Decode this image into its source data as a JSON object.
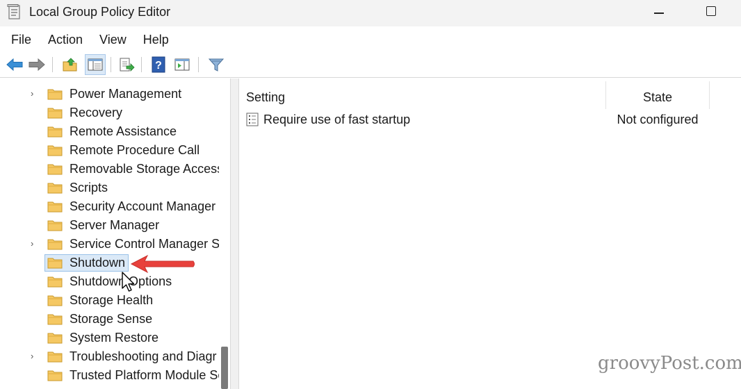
{
  "window": {
    "title": "Local Group Policy Editor",
    "icon": "policy-editor-icon"
  },
  "menu": [
    {
      "label": "File"
    },
    {
      "label": "Action"
    },
    {
      "label": "View"
    },
    {
      "label": "Help"
    }
  ],
  "toolbar": {
    "buttons": [
      {
        "icon": "back-arrow-icon"
      },
      {
        "icon": "forward-arrow-icon"
      },
      {
        "icon": "up-folder-icon"
      },
      {
        "icon": "show-hide-tree-icon"
      },
      {
        "icon": "export-list-icon"
      },
      {
        "icon": "help-icon"
      },
      {
        "icon": "show-action-pane-icon"
      },
      {
        "icon": "filter-icon"
      }
    ]
  },
  "tree": {
    "items": [
      {
        "label": "Power Management",
        "expandable": true
      },
      {
        "label": "Recovery",
        "expandable": false
      },
      {
        "label": "Remote Assistance",
        "expandable": false
      },
      {
        "label": "Remote Procedure Call",
        "expandable": false
      },
      {
        "label": "Removable Storage Access",
        "expandable": false
      },
      {
        "label": "Scripts",
        "expandable": false
      },
      {
        "label": "Security Account Manager",
        "expandable": false
      },
      {
        "label": "Server Manager",
        "expandable": false
      },
      {
        "label": "Service Control Manager Se",
        "expandable": true
      },
      {
        "label": "Shutdown",
        "expandable": false,
        "selected": true
      },
      {
        "label": "Shutdown Options",
        "expandable": false
      },
      {
        "label": "Storage Health",
        "expandable": false
      },
      {
        "label": "Storage Sense",
        "expandable": false
      },
      {
        "label": "System Restore",
        "expandable": false
      },
      {
        "label": "Troubleshooting and Diagr",
        "expandable": true
      },
      {
        "label": "Trusted Platform Module Se",
        "expandable": false
      }
    ]
  },
  "list": {
    "columns": {
      "setting": "Setting",
      "state": "State"
    },
    "rows": [
      {
        "setting": "Require use of fast startup",
        "state": "Not configured"
      }
    ]
  },
  "colors": {
    "annotation_arrow": "#e8413c",
    "selection": "#dbe9f7",
    "folder": "#f5c863"
  },
  "watermark": "groovyPost.com"
}
